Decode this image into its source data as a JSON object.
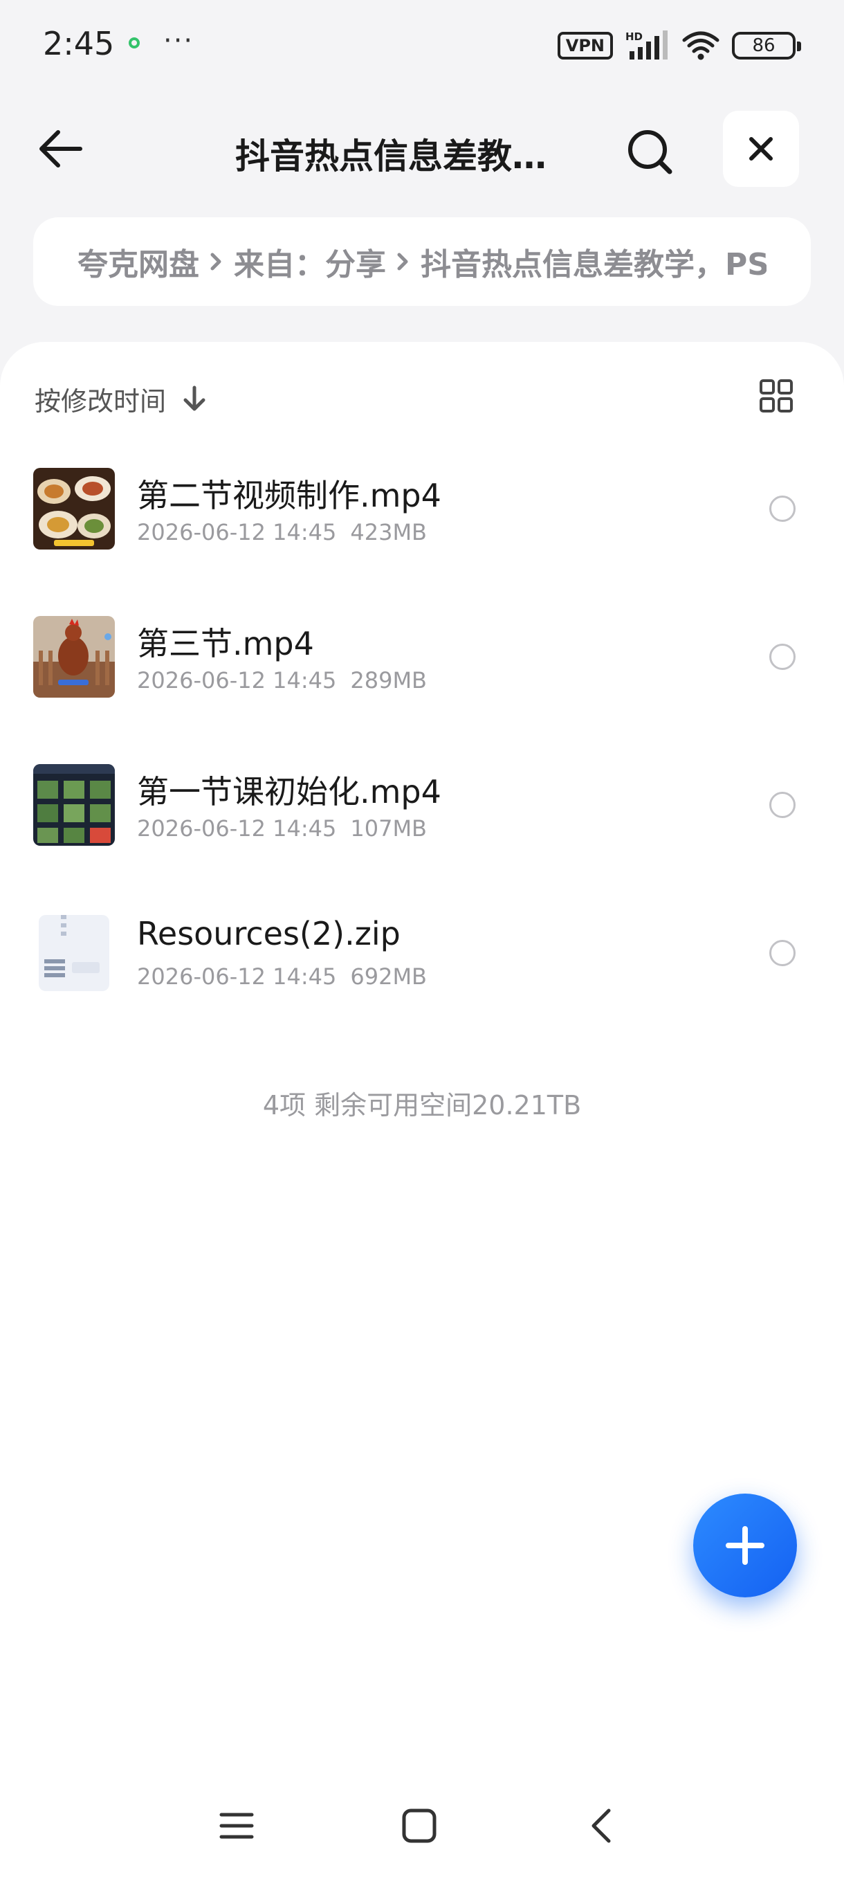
{
  "status_bar": {
    "time": "2:45",
    "more": "···",
    "vpn": "VPN",
    "network": "HD",
    "battery": "86"
  },
  "header": {
    "title": "抖音热点信息差教学，PS...",
    "back_icon": "arrow-left-icon",
    "search_icon": "search-icon",
    "close_icon": "close-icon"
  },
  "breadcrumb": {
    "items": [
      "夸克网盘",
      "来自：分享",
      "抖音热点信息差教学，PS"
    ]
  },
  "toolbar": {
    "sort_label": "按修改时间",
    "sort_icon": "arrow-down-icon",
    "view_icon": "grid-view-icon"
  },
  "files": [
    {
      "name": "第二节视频制作.mp4",
      "date": "2026-06-12 14:45",
      "size": "423MB",
      "thumb": "video-thumbnail-food"
    },
    {
      "name": "第三节.mp4",
      "date": "2026-06-12 14:45",
      "size": "289MB",
      "thumb": "video-thumbnail-rooster"
    },
    {
      "name": "第一节课初始化.mp4",
      "date": "2026-06-12 14:45",
      "size": "107MB",
      "thumb": "video-thumbnail-grid"
    },
    {
      "name": "Resources(2).zip",
      "date": "2026-06-12 14:45",
      "size": "692MB",
      "thumb": "zip-file-icon"
    }
  ],
  "summary": "4项 剩余可用空间20.21TB",
  "fab": {
    "icon": "plus-icon"
  },
  "nav": {
    "icons": [
      "menu-icon",
      "home-icon",
      "back-icon"
    ]
  },
  "colors": {
    "accent": "#1a6ef5",
    "background": "#f4f4f6",
    "muted_text": "#9a9a9e"
  }
}
